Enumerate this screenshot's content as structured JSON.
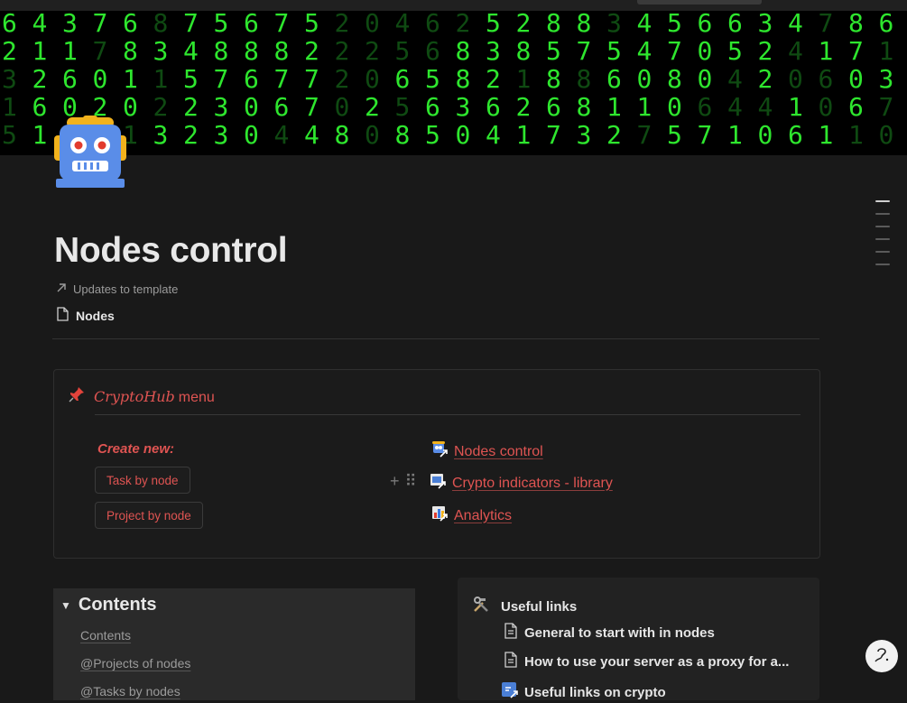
{
  "page": {
    "title": "Nodes control",
    "links": [
      {
        "label": "Updates to template",
        "icon": "arrow-up-right-icon"
      },
      {
        "label": "Nodes",
        "icon": "page-icon"
      }
    ]
  },
  "cover": {
    "digit_rows": [
      "643768756752046252883456634786",
      "211783488822256838575470524171",
      "326011576772065821886080420603",
      "160202230670256362681106441067",
      "515713230448085041732757106110"
    ],
    "bright_rows": [
      "1111101111100000111101111110111",
      "111011111110000111111111110110",
      "011110111110011110101111010011",
      "011110111110101111111110001010",
      "010101111011011111111011111100"
    ],
    "colors": {
      "bright": "#2ee62e",
      "dim": "#0f4a12"
    }
  },
  "menu": {
    "title_italic": "CryptoHub",
    "title_rest": "menu",
    "create_new": "Create new:",
    "buttons": [
      "Task by node",
      "Project by node"
    ],
    "links": [
      "Nodes control",
      "Crypto indicators - library",
      "Analytics"
    ],
    "accent": "#df5452"
  },
  "contents": {
    "heading": "Contents",
    "items": [
      "Contents",
      "@Projects of nodes",
      "@Tasks by nodes"
    ]
  },
  "useful_links": {
    "heading": "Useful links",
    "items": [
      {
        "label": "General to start with in nodes",
        "icon": "document-icon"
      },
      {
        "label": "How to use your server as a proxy for a...",
        "icon": "document-icon"
      },
      {
        "label": "Useful links on crypto",
        "icon": "link-page-icon"
      }
    ]
  }
}
